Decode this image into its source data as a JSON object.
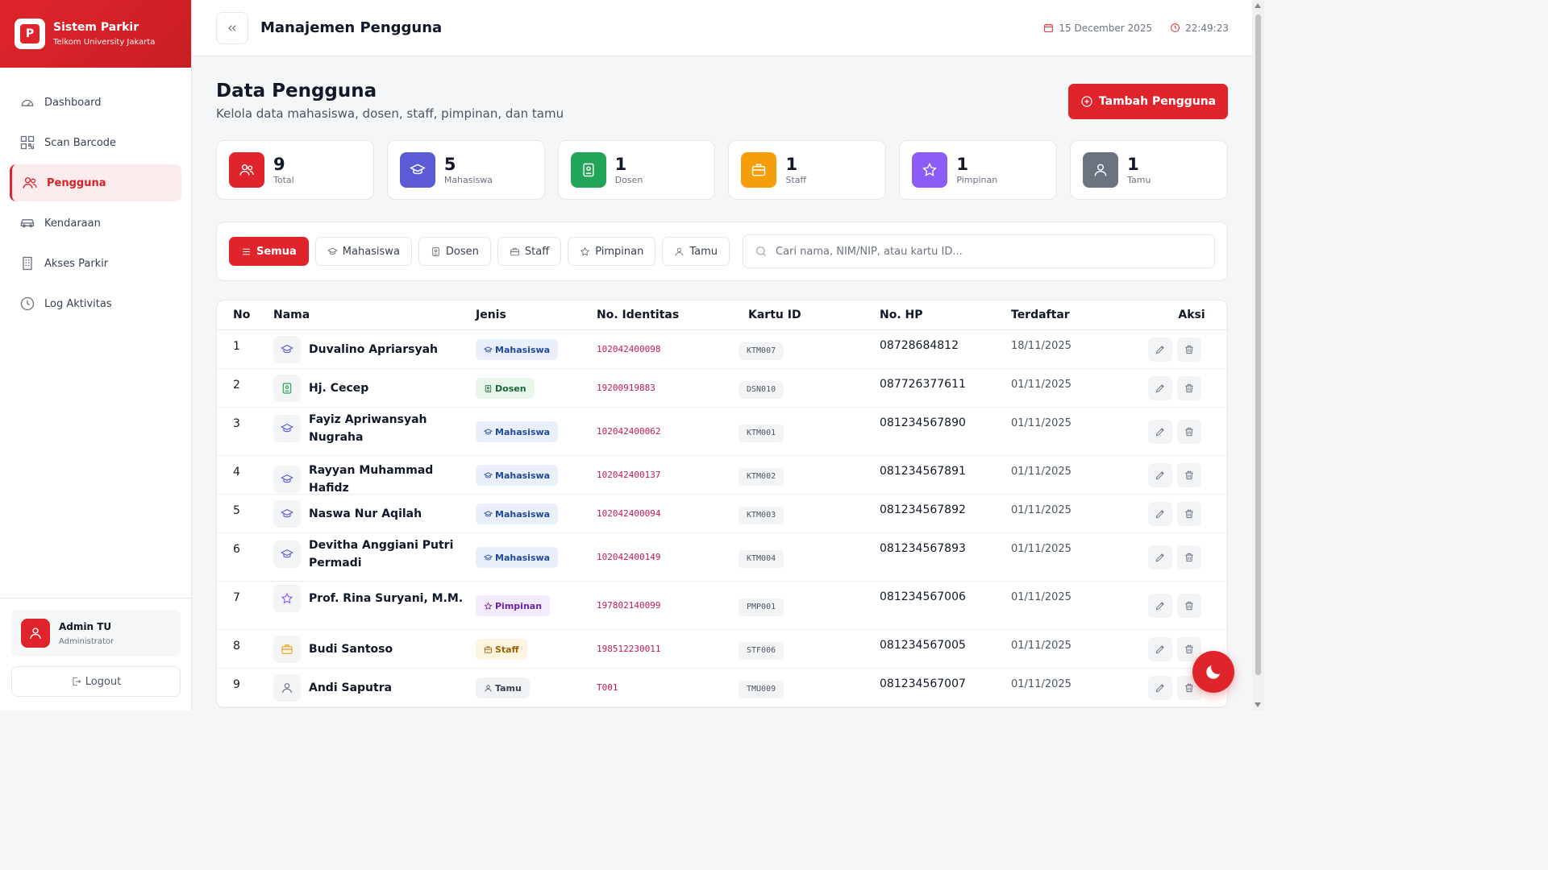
{
  "brand": {
    "logo_letter": "P",
    "title": "Sistem Parkir",
    "subtitle": "Telkom University Jakarta"
  },
  "sidebar": {
    "items": [
      {
        "label": "Dashboard",
        "icon": "gauge-icon",
        "active": false
      },
      {
        "label": "Scan Barcode",
        "icon": "qr-icon",
        "active": false
      },
      {
        "label": "Pengguna",
        "icon": "users-icon",
        "active": true
      },
      {
        "label": "Kendaraan",
        "icon": "car-icon",
        "active": false
      },
      {
        "label": "Akses Parkir",
        "icon": "building-icon",
        "active": false
      },
      {
        "label": "Log Aktivitas",
        "icon": "clock-icon",
        "active": false
      }
    ],
    "user": {
      "name": "Admin TU",
      "role": "Administrator"
    },
    "logout_label": "Logout"
  },
  "header": {
    "title": "Manajemen Pengguna",
    "date": "15 December 2025",
    "time": "22:49:23"
  },
  "page": {
    "title": "Data Pengguna",
    "subtitle": "Kelola data mahasiswa, dosen, staff, pimpinan, dan tamu",
    "add_button": "Tambah Pengguna"
  },
  "stats": [
    {
      "value": "9",
      "label": "Total",
      "color": "#e0242b",
      "icon": "users-icon"
    },
    {
      "value": "5",
      "label": "Mahasiswa",
      "color": "#5b5bd6",
      "icon": "graduation-cap-icon"
    },
    {
      "value": "1",
      "label": "Dosen",
      "color": "#22a559",
      "icon": "id-badge-icon"
    },
    {
      "value": "1",
      "label": "Staff",
      "color": "#f59e0b",
      "icon": "briefcase-icon"
    },
    {
      "value": "1",
      "label": "Pimpinan",
      "color": "#8b5cf6",
      "icon": "star-icon"
    },
    {
      "value": "1",
      "label": "Tamu",
      "color": "#6b7280",
      "icon": "user-icon"
    }
  ],
  "filters": {
    "buttons": [
      "Semua",
      "Mahasiswa",
      "Dosen",
      "Staff",
      "Pimpinan",
      "Tamu"
    ],
    "active": "Semua",
    "search_placeholder": "Cari nama, NIM/NIP, atau kartu ID..."
  },
  "table": {
    "headers": [
      "No",
      "Nama",
      "Jenis",
      "No. Identitas",
      "Kartu ID",
      "No. HP",
      "Terdaftar",
      "Aksi"
    ],
    "rows": [
      {
        "no": "1",
        "name": "Duvalino Apriarsyah",
        "jenis": "Mahasiswa",
        "identitas": "102042400098",
        "kartu": "KTM007",
        "hp": "08728684812",
        "terdaftar": "18/11/2025"
      },
      {
        "no": "2",
        "name": "Hj. Cecep",
        "jenis": "Dosen",
        "identitas": "19200919883",
        "kartu": "DSN010",
        "hp": "087726377611",
        "terdaftar": "01/11/2025"
      },
      {
        "no": "3",
        "name": "Fayiz Apriwansyah Nugraha",
        "jenis": "Mahasiswa",
        "identitas": "102042400062",
        "kartu": "KTM001",
        "hp": "081234567890",
        "terdaftar": "01/11/2025"
      },
      {
        "no": "4",
        "name": "Rayyan Muhammad Hafidz",
        "jenis": "Mahasiswa",
        "identitas": "102042400137",
        "kartu": "KTM002",
        "hp": "081234567891",
        "terdaftar": "01/11/2025"
      },
      {
        "no": "5",
        "name": "Naswa Nur Aqilah",
        "jenis": "Mahasiswa",
        "identitas": "102042400094",
        "kartu": "KTM003",
        "hp": "081234567892",
        "terdaftar": "01/11/2025"
      },
      {
        "no": "6",
        "name": "Devitha Anggiani Putri Permadi",
        "jenis": "Mahasiswa",
        "identitas": "102042400149",
        "kartu": "KTM004",
        "hp": "081234567893",
        "terdaftar": "01/11/2025"
      },
      {
        "no": "7",
        "name": "Prof. Rina Suryani, M.M.",
        "jenis": "Pimpinan",
        "identitas": "197802140099",
        "kartu": "PMP001",
        "hp": "081234567006",
        "terdaftar": "01/11/2025"
      },
      {
        "no": "8",
        "name": "Budi Santoso",
        "jenis": "Staff",
        "identitas": "198512230011",
        "kartu": "STF006",
        "hp": "081234567005",
        "terdaftar": "01/11/2025"
      },
      {
        "no": "9",
        "name": "Andi Saputra",
        "jenis": "Tamu",
        "identitas": "T001",
        "kartu": "TMU009",
        "hp": "081234567007",
        "terdaftar": "01/11/2025"
      }
    ]
  },
  "colors": {
    "accent": "#e0242b"
  }
}
